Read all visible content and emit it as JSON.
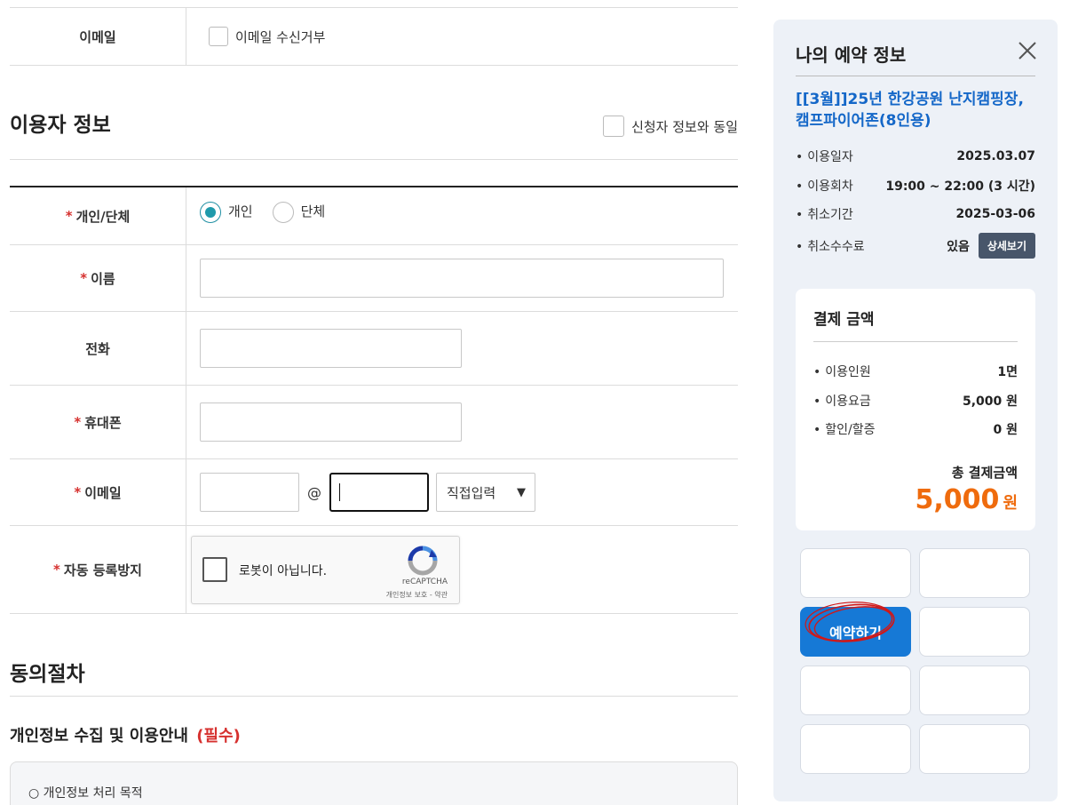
{
  "email_top": {
    "label": "이메일",
    "optout_label": "이메일 수신거부"
  },
  "user_info": {
    "title": "이용자 정보",
    "same_as_applicant": "신청자 정보와 동일",
    "type": {
      "label": "개인/단체",
      "options": [
        "개인",
        "단체"
      ],
      "selected": "개인"
    },
    "name_label": "이름",
    "phone_label": "전화",
    "mobile_label": "휴대폰",
    "email_label": "이메일",
    "email_at": "@",
    "email_domain_select": "직접입력",
    "captcha_label": "자동 등록방지",
    "required_mark": "*"
  },
  "captcha": {
    "label": "로봇이 아닙니다.",
    "brand": "reCAPTCHA",
    "terms": "개인정보 보호 - 약관"
  },
  "consent": {
    "title": "동의절차",
    "privacy_title": "개인정보 수집 및 이용안내",
    "privacy_required": "(필수)",
    "purpose_item": "○ 개인정보 처리 목적"
  },
  "reservation": {
    "title": "나의 예약 정보",
    "program": "[[3월]]25년 한강공원 난지캠핑장, 캠프파이어존(8인용)",
    "info": [
      {
        "key": "이용일자",
        "value": "2025.03.07"
      },
      {
        "key": "이용회차",
        "value": "19:00 ~ 22:00 (3 시간)"
      },
      {
        "key": "취소기간",
        "value": "2025-03-06"
      },
      {
        "key": "취소수수료",
        "value": "있음"
      }
    ],
    "detail_button": "상세보기"
  },
  "payment": {
    "title": "결제 금액",
    "rows": [
      {
        "key": "이용인원",
        "value": "1면"
      },
      {
        "key": "이용요금",
        "value": "5,000 원"
      },
      {
        "key": "할인/할증",
        "value": "0 원"
      }
    ],
    "total_label": "총 결제금액",
    "total_amount": "5,000",
    "total_unit": "원"
  },
  "actions": {
    "reserve_button": "예약하기"
  },
  "colors": {
    "accent_blue": "#1679d6",
    "program_blue": "#1467c8",
    "total_orange": "#ef6b0d",
    "required_red": "#d6312f",
    "radio_teal": "#1f9aab",
    "panel_bg": "#edf1f7"
  }
}
